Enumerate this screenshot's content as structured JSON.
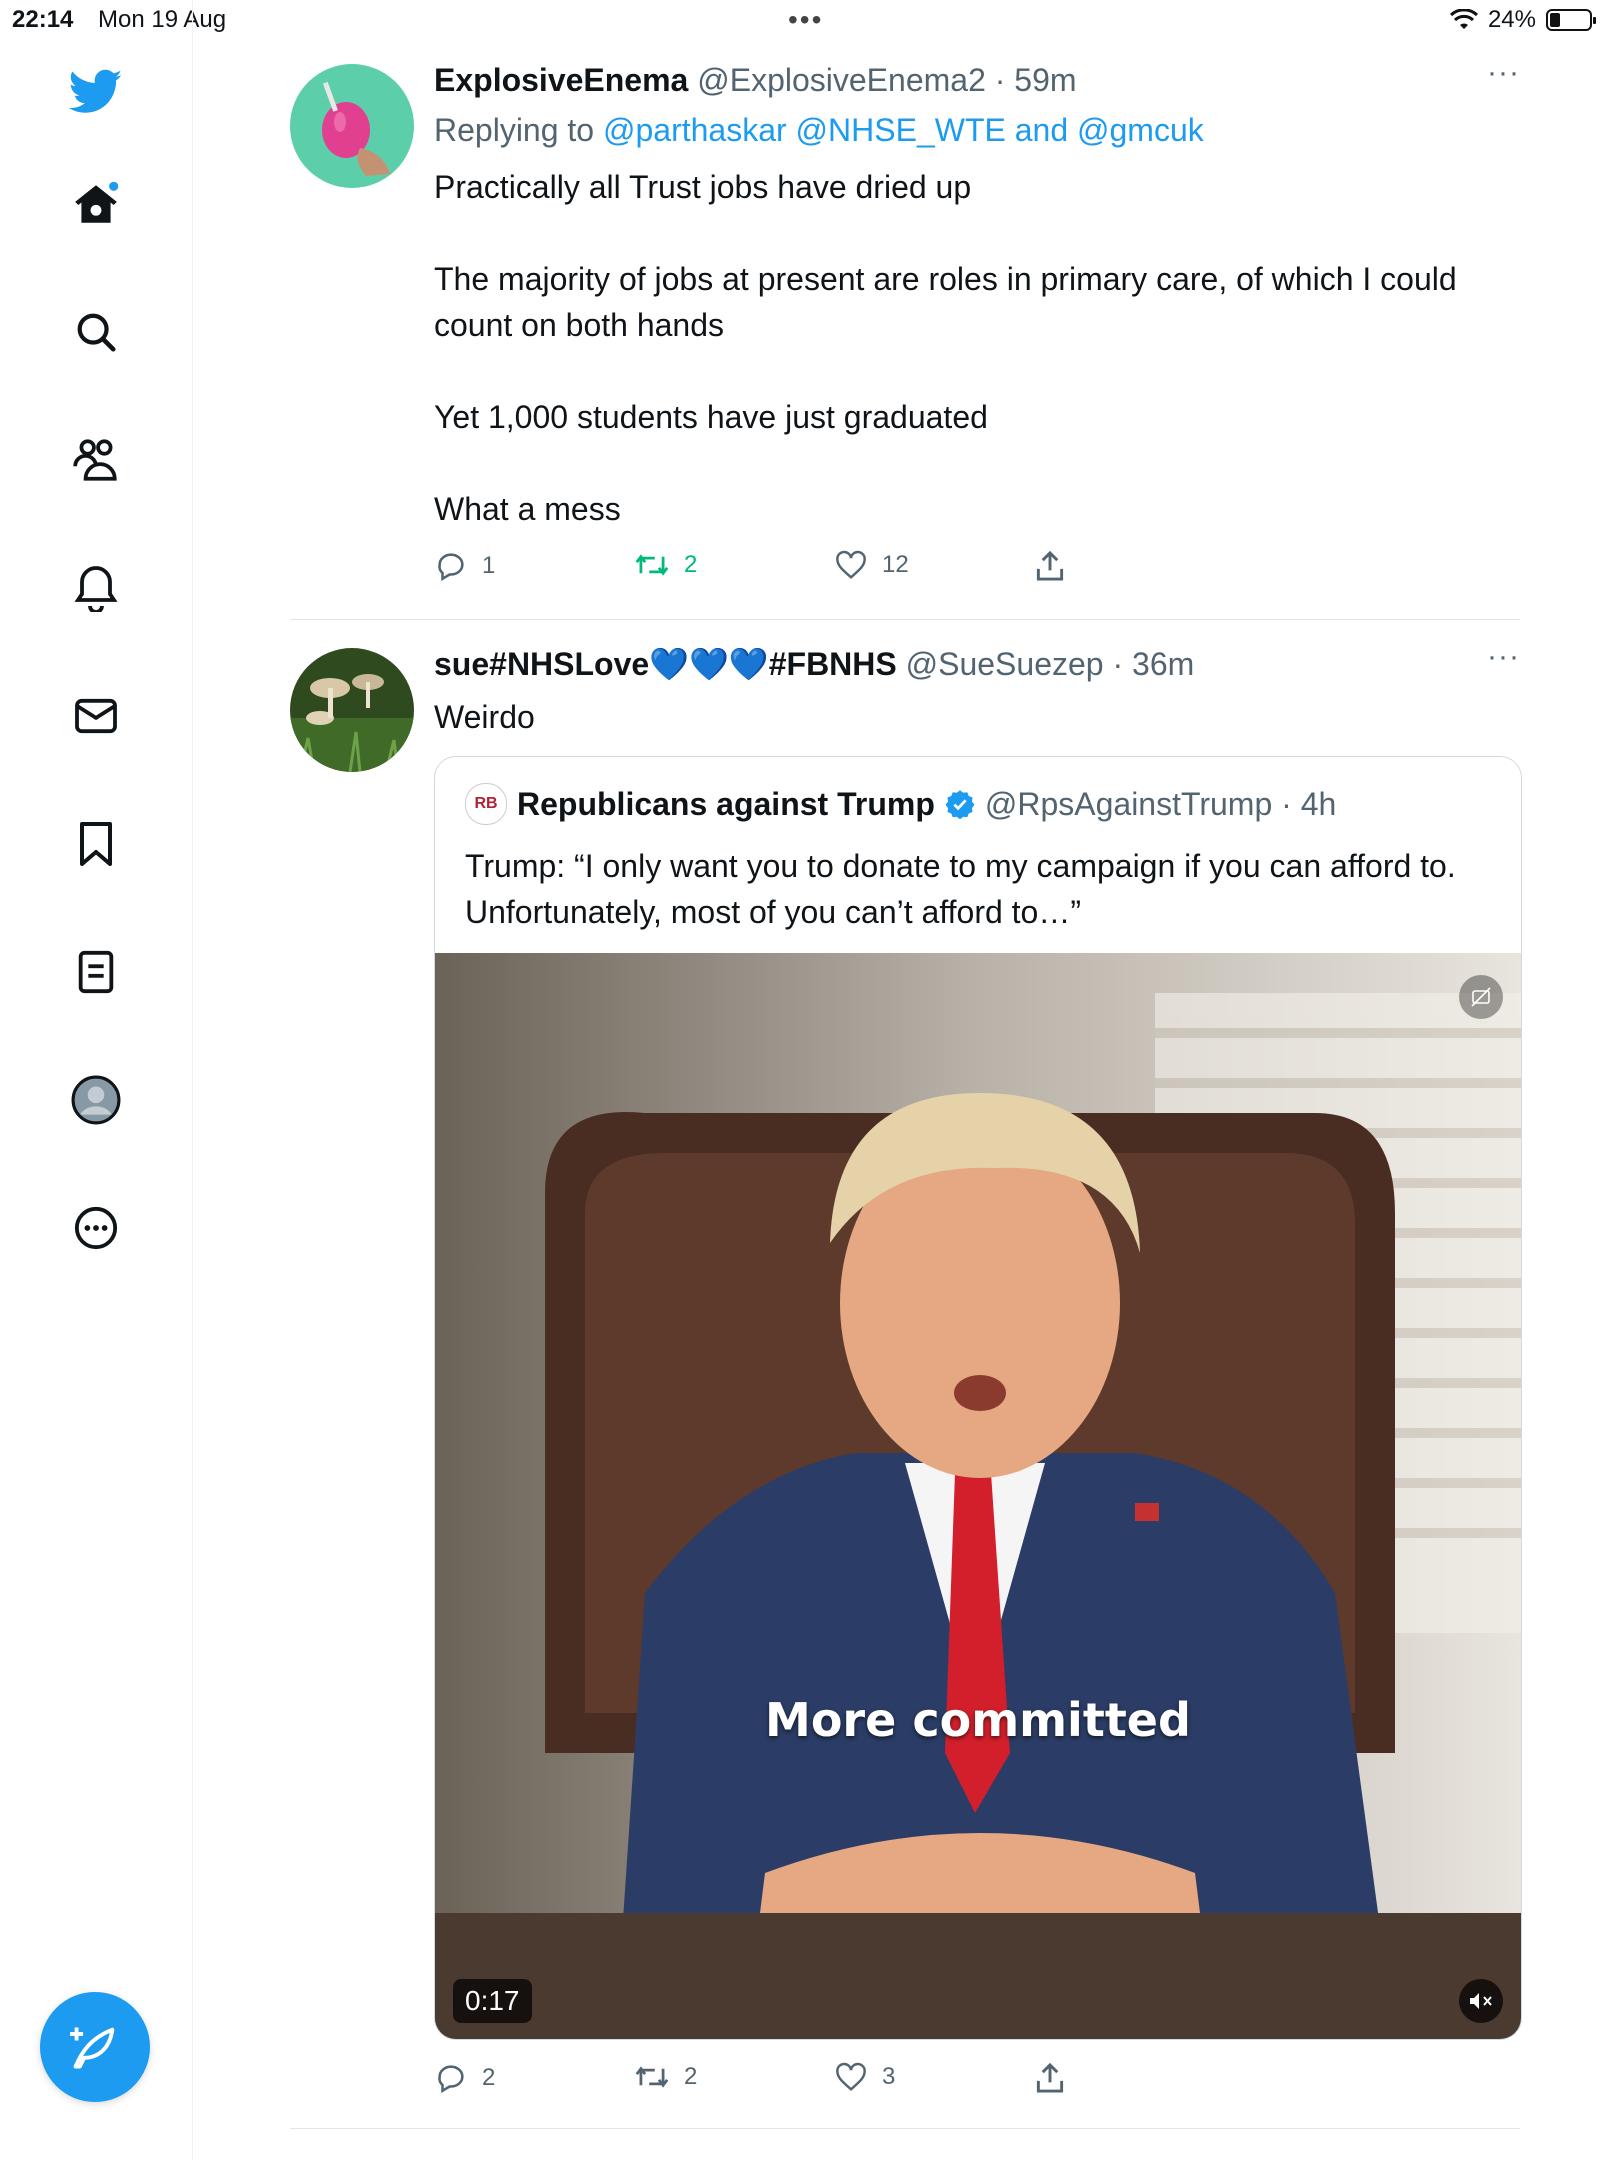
{
  "status_bar": {
    "time": "22:14",
    "date": "Mon 19 Aug",
    "battery": "24%"
  },
  "nav": {
    "items": [
      {
        "name": "home"
      },
      {
        "name": "explore"
      },
      {
        "name": "communities"
      },
      {
        "name": "notifications"
      },
      {
        "name": "messages"
      },
      {
        "name": "bookmarks"
      },
      {
        "name": "lists"
      },
      {
        "name": "profile"
      },
      {
        "name": "more"
      }
    ]
  },
  "tweets": [
    {
      "display_name": "ExplosiveEnema",
      "handle": "@ExplosiveEnema2",
      "sep": " · ",
      "time": "59m",
      "replying_prefix": "Replying to ",
      "replying_to_1": "@parthaskar",
      "replying_to_2": "@NHSE_WTE",
      "replying_and": " and ",
      "replying_to_3": "@gmcuk",
      "text": "Practically all Trust jobs have dried up\n\nThe majority of jobs at present are roles in primary care, of which I could count on both hands\n\nYet 1,000 students have just graduated\n\nWhat a mess",
      "replies": "1",
      "retweets": "2",
      "likes": "12"
    },
    {
      "display_name": "sue#NHSLove💙💙💙#FBNHS",
      "handle": "@SueSuezep",
      "sep": " · ",
      "time": "36m",
      "text": "Weirdo",
      "quote": {
        "display_name": "Republicans against Trump",
        "avatar_text": "RB",
        "handle": "@RpsAgainstTrump",
        "sep": " · ",
        "time": "4h",
        "text": "Trump: “I only want you to donate to my campaign if you can afford to. Unfortunately, most of you can’t afford to…”",
        "video_caption": "More committed",
        "video_duration": "0:17"
      },
      "replies": "2",
      "retweets": "2",
      "likes": "3"
    }
  ],
  "colors": {
    "accent": "#1d9bf0",
    "retweet_active": "#00ba7c",
    "muted": "#536471"
  }
}
